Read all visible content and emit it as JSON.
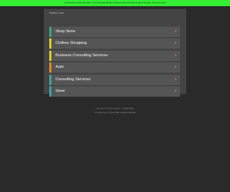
{
  "banner": {
    "text": "Interested in this domain? Our Premium Broker Service may be able to get it for you. Find out how"
  },
  "panel": {
    "heading": "Related Links",
    "items": [
      {
        "label": "Shop Store",
        "accent": "#3aa882"
      },
      {
        "label": "Clothes Shopping",
        "accent": "#e3d51a"
      },
      {
        "label": "Business Consulting Services",
        "accent": "#e3d51a"
      },
      {
        "label": "Auld",
        "accent": "#f08a1a"
      },
      {
        "label": "Consulting Services",
        "accent": "#3aa8a8"
      },
      {
        "label": "Store",
        "accent": "#3aa8a8"
      }
    ],
    "arrow": "»"
  },
  "footer": {
    "line1_prefix": "Copyright © All rights reserved.",
    "line1_link": "Privacy Policy",
    "line2_prefix": "This Web page is parked FREE,",
    "line2_link": "courtesy of Domain"
  },
  "colors": {
    "background": "#2a2a2a",
    "panel": "#444444",
    "row": "#555555",
    "banner": "#33ee33",
    "arrow": "#e8a13a"
  }
}
